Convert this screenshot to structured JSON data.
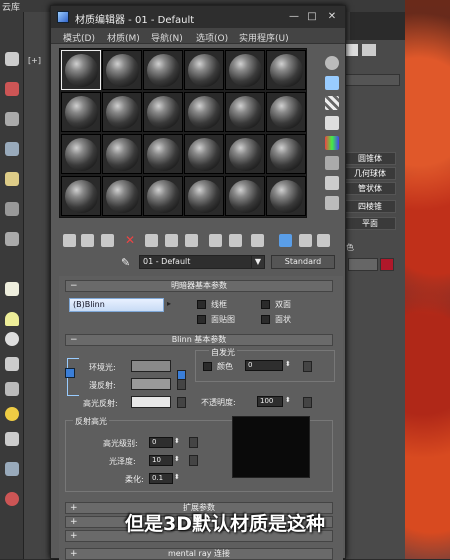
{
  "background_app": {
    "title": "云库",
    "viewport_label": "[+]",
    "command_panel_buttons": [
      "圆锥体",
      "几何球体",
      "管状体",
      "四棱锥",
      "平面"
    ],
    "command_panel_extra": "色"
  },
  "dialog": {
    "title": "材质编辑器 - 01 - Default",
    "window_buttons": {
      "minimize": "—",
      "maximize": "□",
      "close": "✕"
    },
    "menu": [
      "模式(D)",
      "材质(M)",
      "导航(N)",
      "选项(O)",
      "实用程序(U)"
    ],
    "material_name": "01 - Default",
    "material_type": "Standard",
    "sample_slots": {
      "rows": 4,
      "cols": 6,
      "selected_index": 0
    }
  },
  "rollouts": {
    "shader_basic": {
      "title": "明暗器基本参数",
      "shader": "(B)Blinn",
      "checkboxes": [
        "线框",
        "双面",
        "面贴图",
        "面状"
      ]
    },
    "blinn_basic": {
      "title": "Blinn 基本参数",
      "ambient": "环境光:",
      "diffuse": "漫反射:",
      "specular": "高光反射:",
      "self_illum_group": "自发光",
      "color_label": "颜色",
      "color_value": "0",
      "opacity_label": "不透明度:",
      "opacity_value": "100",
      "spec_group": "反射高光",
      "spec_level_label": "高光级别:",
      "spec_level_value": "0",
      "gloss_label": "光泽度:",
      "gloss_value": "10",
      "soften_label": "柔化:",
      "soften_value": "0.1"
    },
    "extended": {
      "title": "扩展参数"
    },
    "mental_ray": {
      "title": "mental ray 连接"
    }
  },
  "caption": "但是3D默认材质是这种",
  "colors": {
    "shader_dropdown": "#dce8fa",
    "photo_accent": "#c0301a",
    "command_swatch": "#b0182a"
  }
}
